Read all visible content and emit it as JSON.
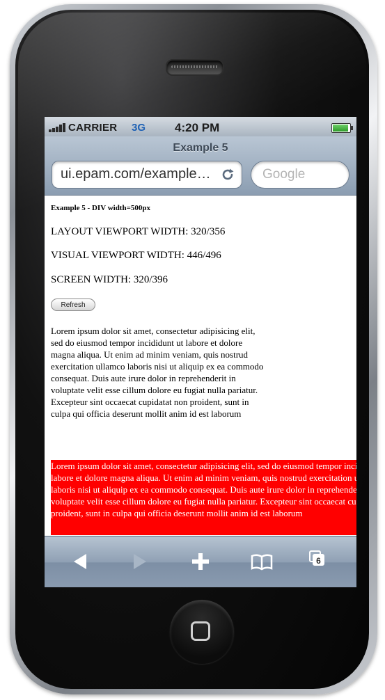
{
  "status": {
    "carrier": "CARRIER",
    "network": "3G",
    "time": "4:20 PM"
  },
  "browser": {
    "page_title": "Example 5",
    "url": "ui.epam.com/example…",
    "search_placeholder": "Google"
  },
  "content": {
    "heading": "Example 5 - DIV width=500px",
    "layout_viewport": "LAYOUT VIEWPORT WIDTH: 320/356",
    "visual_viewport": "VISUAL VIEWPORT WIDTH: 446/496",
    "screen_width": "SCREEN WIDTH: 320/396",
    "refresh_label": "Refresh",
    "lorem_plain": "Lorem ipsum dolor sit amet, consectetur adipisicing elit, sed do eiusmod tempor incididunt ut labore et dolore magna aliqua. Ut enim ad minim veniam, quis nostrud exercitation ullamco laboris nisi ut aliquip ex ea commodo consequat. Duis aute irure dolor in reprehenderit in voluptate velit esse cillum dolore eu fugiat nulla pariatur. Excepteur sint occaecat cupidatat non proident, sunt in culpa qui officia deserunt mollit anim id est laborum",
    "lorem_red": "Lorem ipsum dolor sit amet, consectetur adipisicing elit, sed do eiusmod tempor incididunt ut labore et dolore magna aliqua. Ut enim ad minim veniam, quis nostrud exercitation ullamco laboris nisi ut aliquip ex ea commodo consequat. Duis aute irure dolor in reprehenderit in voluptate velit esse cillum dolore eu fugiat nulla pariatur. Excepteur sint occaecat cupidatat non proident, sunt in culpa qui officia deserunt mollit anim id est laborum",
    "red_box_color": "#ff0000"
  },
  "toolbar": {
    "tabs_count": "6",
    "icons": [
      "back-arrow-icon",
      "forward-arrow-icon",
      "plus-icon",
      "bookmarks-icon",
      "tabs-icon"
    ]
  }
}
